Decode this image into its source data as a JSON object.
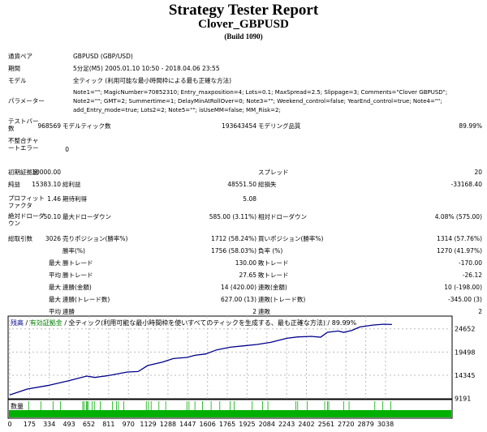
{
  "header": {
    "title": "Strategy Tester Report",
    "expert": "Clover_GBPUSD",
    "build": "(Build 1090)"
  },
  "info": {
    "symbol_label": "通貨ペア",
    "symbol": "GBPUSD (GBP/USD)",
    "period_label": "期間",
    "period": "5分足(M5) 2005.01.10 10:50 - 2018.04.06 23:55",
    "model_label": "モデル",
    "model": "全ティック (利用可能な最小時間枠による最も正確な方法)",
    "params_label": "パラメーター",
    "params": "Note1=\"\"; MagicNumber=70852310; Entry_maxposition=4; Lots=0.1; MaxSpread=2.5; Slippage=3; Comments=\"Clover GBPUSD\"; Note2=\"\"; GMT=2; Summertime=1; DelayMinAtRollOver=0; Note3=\"\"; Weekend_control=false; YearEnd_control=true; Note4=\"\"; add_Entry_mode=true; Lots2=2; Note5=\"\"; isUseMM=false; MM_Risk=2;"
  },
  "stats": {
    "bars_label": "テストバー数",
    "bars": "968569",
    "ticks_label": "モデルティック数",
    "ticks": "193643454",
    "quality_label": "モデリング品質",
    "quality": "89.99%",
    "mismatch_label": "不整合チャートエラー",
    "mismatch": "0",
    "deposit_label": "初期証拠金",
    "deposit": "10000.00",
    "spread_label": "スプレッド",
    "spread": "20",
    "net_label": "純益",
    "net": "15383.10",
    "gross_profit_label": "総利益",
    "gross_profit": "48551.50",
    "gross_loss_label": "総損失",
    "gross_loss": "-33168.40",
    "pf_label": "プロフィットファクタ",
    "pf": "1.46",
    "expected_label": "期待利得",
    "expected": "5.08",
    "abs_dd_label": "絶対ドローダウン",
    "abs_dd": "50.10",
    "max_dd_label": "最大ドローダウン",
    "max_dd": "585.00 (3.11%)",
    "rel_dd_label": "相対ドローダウン",
    "rel_dd": "4.08% (575.00)",
    "total_label": "総取引数",
    "total": "3026",
    "short_label": "売りポジション(勝率%)",
    "short": "1712 (58.24%)",
    "long_label": "買いポジション(勝率%)",
    "long": "1314 (57.76%)",
    "win_label": "勝率(%)",
    "win": "1756 (58.03%)",
    "loss_label": "負率 (%)",
    "loss": "1270 (41.97%)",
    "r1_pre": "最大",
    "r1_a": "勝トレード",
    "r1_av": "130.00",
    "r1_b": "敗トレード",
    "r1_bv": "-170.00",
    "r2_pre": "平均",
    "r2_a": "勝トレード",
    "r2_av": "27.65",
    "r2_b": "敗トレード",
    "r2_bv": "-26.12",
    "r3_pre": "最大",
    "r3_a": "連勝(金額)",
    "r3_av": "14 (420.00)",
    "r3_b": "連敗(金額)",
    "r3_bv": "10 (-198.00)",
    "r4_pre": "最大",
    "r4_a": "連勝(トレード数)",
    "r4_av": "627.00 (13)",
    "r4_b": "連敗(トレード数)",
    "r4_bv": "-345.00 (3)",
    "r5_pre": "平均",
    "r5_a": "連勝",
    "r5_av": "2",
    "r5_b": "連敗",
    "r5_bv": "2"
  },
  "chart_data": {
    "type": "line",
    "legend": {
      "balance": "残高",
      "sep1": " / ",
      "equity": "有効証拠金",
      "sep2": " / ",
      "model": "全ティック(利用可能な最小時間枠を使いすべてのティックを生成する、最も正確な方法) / 89.99%"
    },
    "colors": {
      "balance": "#00008b",
      "equity": "#008000",
      "volume": "#00b000"
    },
    "y_ticks": [
      "24652",
      "19498",
      "14345",
      "9191"
    ],
    "x_ticks": [
      "0",
      "175",
      "334",
      "493",
      "652",
      "811",
      "970",
      "1129",
      "1288",
      "1447",
      "1606",
      "1765",
      "1925",
      "2084",
      "2243",
      "2402",
      "2561",
      "2720",
      "2879",
      "3038"
    ],
    "ylim": [
      9191,
      26500
    ],
    "xlim": [
      0,
      3090
    ],
    "grid": true,
    "volume_label": "数量",
    "balance": [
      [
        0,
        10000
      ],
      [
        142,
        11288
      ],
      [
        306,
        12067
      ],
      [
        470,
        13086
      ],
      [
        623,
        14164
      ],
      [
        688,
        13865
      ],
      [
        798,
        14284
      ],
      [
        951,
        15063
      ],
      [
        1038,
        15183
      ],
      [
        1115,
        16502
      ],
      [
        1235,
        17281
      ],
      [
        1322,
        18060
      ],
      [
        1432,
        18299
      ],
      [
        1497,
        18779
      ],
      [
        1585,
        19079
      ],
      [
        1672,
        19977
      ],
      [
        1781,
        20577
      ],
      [
        1891,
        20876
      ],
      [
        2000,
        21176
      ],
      [
        2109,
        21655
      ],
      [
        2240,
        22554
      ],
      [
        2328,
        22854
      ],
      [
        2437,
        22974
      ],
      [
        2513,
        22794
      ],
      [
        2568,
        23873
      ],
      [
        2655,
        24173
      ],
      [
        2699,
        23873
      ],
      [
        2765,
        24292
      ],
      [
        2830,
        25072
      ],
      [
        2940,
        25491
      ],
      [
        3026,
        25671
      ],
      [
        3090,
        25611
      ]
    ],
    "volume_spikes": [
      153,
      251,
      350,
      409,
      590,
      601,
      619,
      627,
      636,
      667,
      684,
      732,
      831,
      863,
      879,
      922,
      1104,
      1121,
      1143,
      1206,
      1261,
      1432,
      1449,
      1497,
      1558,
      1628,
      1698,
      1781,
      1814,
      1960,
      2044,
      2087,
      2312,
      2328,
      2404,
      2546,
      2568,
      2579,
      2699,
      2743,
      2951,
      3016,
      3080
    ]
  }
}
